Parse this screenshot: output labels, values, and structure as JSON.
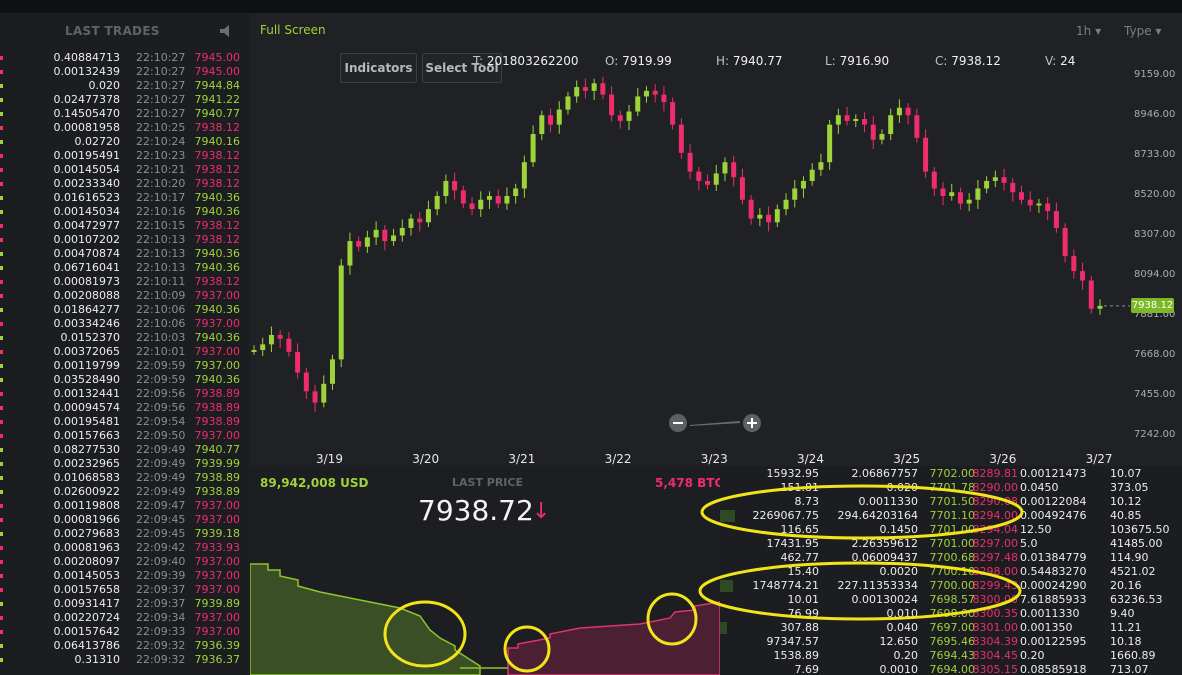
{
  "trades": {
    "title": "LAST TRADES",
    "rows": [
      {
        "amt": "0.40884713",
        "time": "22:10:27",
        "price": "7945.00",
        "dir": "dn"
      },
      {
        "amt": "0.00132439",
        "time": "22:10:27",
        "price": "7945.00",
        "dir": "dn"
      },
      {
        "amt": "0.020",
        "time": "22:10:27",
        "price": "7944.84",
        "dir": "up"
      },
      {
        "amt": "0.02477378",
        "time": "22:10:27",
        "price": "7941.22",
        "dir": "up"
      },
      {
        "amt": "0.14505470",
        "time": "22:10:27",
        "price": "7940.77",
        "dir": "up"
      },
      {
        "amt": "0.00081958",
        "time": "22:10:25",
        "price": "7938.12",
        "dir": "dn"
      },
      {
        "amt": "0.02720",
        "time": "22:10:24",
        "price": "7940.16",
        "dir": "up"
      },
      {
        "amt": "0.00195491",
        "time": "22:10:23",
        "price": "7938.12",
        "dir": "dn"
      },
      {
        "amt": "0.00145054",
        "time": "22:10:21",
        "price": "7938.12",
        "dir": "dn"
      },
      {
        "amt": "0.00233340",
        "time": "22:10:20",
        "price": "7938.12",
        "dir": "dn"
      },
      {
        "amt": "0.01616523",
        "time": "22:10:17",
        "price": "7940.36",
        "dir": "up"
      },
      {
        "amt": "0.00145034",
        "time": "22:10:16",
        "price": "7940.36",
        "dir": "up"
      },
      {
        "amt": "0.00472977",
        "time": "22:10:15",
        "price": "7938.12",
        "dir": "dn"
      },
      {
        "amt": "0.00107202",
        "time": "22:10:13",
        "price": "7938.12",
        "dir": "dn"
      },
      {
        "amt": "0.00470874",
        "time": "22:10:13",
        "price": "7940.36",
        "dir": "up"
      },
      {
        "amt": "0.06716041",
        "time": "22:10:13",
        "price": "7940.36",
        "dir": "up"
      },
      {
        "amt": "0.00081973",
        "time": "22:10:11",
        "price": "7938.12",
        "dir": "dn"
      },
      {
        "amt": "0.00208088",
        "time": "22:10:09",
        "price": "7937.00",
        "dir": "dn"
      },
      {
        "amt": "0.01864277",
        "time": "22:10:06",
        "price": "7940.36",
        "dir": "up"
      },
      {
        "amt": "0.00334246",
        "time": "22:10:06",
        "price": "7937.00",
        "dir": "dn"
      },
      {
        "amt": "0.0152370",
        "time": "22:10:03",
        "price": "7940.36",
        "dir": "up"
      },
      {
        "amt": "0.00372065",
        "time": "22:10:01",
        "price": "7937.00",
        "dir": "dn"
      },
      {
        "amt": "0.00119799",
        "time": "22:09:59",
        "price": "7937.00",
        "dir": "up"
      },
      {
        "amt": "0.03528490",
        "time": "22:09:59",
        "price": "7940.36",
        "dir": "up"
      },
      {
        "amt": "0.00132441",
        "time": "22:09:56",
        "price": "7938.89",
        "dir": "dn"
      },
      {
        "amt": "0.00094574",
        "time": "22:09:56",
        "price": "7938.89",
        "dir": "dn"
      },
      {
        "amt": "0.00195481",
        "time": "22:09:54",
        "price": "7938.89",
        "dir": "dn"
      },
      {
        "amt": "0.00157663",
        "time": "22:09:50",
        "price": "7937.00",
        "dir": "dn"
      },
      {
        "amt": "0.08277530",
        "time": "22:09:49",
        "price": "7940.77",
        "dir": "up"
      },
      {
        "amt": "0.00232965",
        "time": "22:09:49",
        "price": "7939.99",
        "dir": "up"
      },
      {
        "amt": "0.01068583",
        "time": "22:09:49",
        "price": "7938.89",
        "dir": "up"
      },
      {
        "amt": "0.02600922",
        "time": "22:09:49",
        "price": "7938.89",
        "dir": "up"
      },
      {
        "amt": "0.00119808",
        "time": "22:09:47",
        "price": "7937.00",
        "dir": "dn"
      },
      {
        "amt": "0.00081966",
        "time": "22:09:45",
        "price": "7937.00",
        "dir": "dn"
      },
      {
        "amt": "0.00279683",
        "time": "22:09:45",
        "price": "7939.18",
        "dir": "up"
      },
      {
        "amt": "0.00081963",
        "time": "22:09:42",
        "price": "7933.93",
        "dir": "dn"
      },
      {
        "amt": "0.00208097",
        "time": "22:09:40",
        "price": "7937.00",
        "dir": "dn"
      },
      {
        "amt": "0.00145053",
        "time": "22:09:39",
        "price": "7937.00",
        "dir": "dn"
      },
      {
        "amt": "0.00157658",
        "time": "22:09:37",
        "price": "7937.00",
        "dir": "dn"
      },
      {
        "amt": "0.00931417",
        "time": "22:09:37",
        "price": "7939.89",
        "dir": "up"
      },
      {
        "amt": "0.00220724",
        "time": "22:09:34",
        "price": "7937.00",
        "dir": "dn"
      },
      {
        "amt": "0.00157642",
        "time": "22:09:33",
        "price": "7937.00",
        "dir": "dn"
      },
      {
        "amt": "0.06413786",
        "time": "22:09:32",
        "price": "7936.39",
        "dir": "up"
      },
      {
        "amt": "0.31310",
        "time": "22:09:32",
        "price": "7936.37",
        "dir": "up"
      }
    ]
  },
  "chart": {
    "fullscreen_label": "Full Screen",
    "indicators_label": "Indicators",
    "select_tool_label": "Select Tool",
    "interval_label": "1h",
    "type_label": "Type",
    "ohlc": {
      "t_label": "T:",
      "t_value": "201803262200",
      "o_label": "O:",
      "o_value": "7919.99",
      "h_label": "H:",
      "h_value": "7940.77",
      "l_label": "L:",
      "l_value": "7916.90",
      "c_label": "C:",
      "c_value": "7938.12",
      "v_label": "V:",
      "v_value": "24"
    },
    "current_price_tag": "7938.12",
    "colors": {
      "up": "#9fd33a",
      "down": "#ee2d6a",
      "bg": "#1f2124"
    }
  },
  "chart_data": {
    "type": "line",
    "title": "",
    "xlabel": "",
    "ylabel": "",
    "x_ticks": [
      "3/19",
      "3/20",
      "3/21",
      "3/22",
      "3/23",
      "3/24",
      "3/25",
      "3/26",
      "3/27"
    ],
    "y_ticks": [
      9159.0,
      8946.0,
      8733.0,
      8520.0,
      8307.0,
      8094.0,
      7881.0,
      7668.0,
      7455.0,
      7242.0
    ],
    "ylim": [
      7242,
      9159
    ],
    "series": [
      {
        "values": [
          7700,
          7730,
          7780,
          7760,
          7690,
          7580,
          7480,
          7420,
          7520,
          7650,
          8150,
          8280,
          8250,
          8300,
          8340,
          8280,
          8310,
          8350,
          8400,
          8380,
          8450,
          8520,
          8600,
          8550,
          8480,
          8450,
          8500,
          8520,
          8480,
          8520,
          8560,
          8700,
          8850,
          8950,
          8900,
          8980,
          9050,
          9100,
          9080,
          9120,
          9060,
          8950,
          8920,
          8970,
          9050,
          9080,
          9060,
          9020,
          8900,
          8750,
          8650,
          8600,
          8580,
          8640,
          8700,
          8620,
          8500,
          8400,
          8420,
          8380,
          8450,
          8500,
          8560,
          8600,
          8660,
          8700,
          8900,
          8950,
          8920,
          8930,
          8900,
          8820,
          8850,
          8950,
          8990,
          8950,
          8830,
          8650,
          8560,
          8520,
          8540,
          8480,
          8500,
          8560,
          8600,
          8620,
          8590,
          8540,
          8500,
          8470,
          8480,
          8440,
          8350,
          8200,
          8120,
          8070,
          7920,
          7935
        ]
      }
    ],
    "grid": false
  },
  "depth": {
    "bid_total": "89,942,008 USD",
    "last_price_label": "LAST PRICE",
    "last_price": "7938.72",
    "last_price_arrow": "↓",
    "ask_total": "5,478 BTC"
  },
  "book": {
    "rows": [
      {
        "a": "15932.95",
        "b": "2.06867757",
        "bid": "7702.00",
        "ask": "8289.81",
        "d": "0.00121473",
        "e": "10.07",
        "bar": 0.0
      },
      {
        "a": "151.81",
        "b": "0.020",
        "bid": "7701.78",
        "ask": "8290.00",
        "d": "0.0450",
        "e": "373.05",
        "bar": 0.0
      },
      {
        "a": "8.73",
        "b": "0.0011330",
        "bid": "7701.50",
        "ask": "8290.08",
        "d": "0.00122084",
        "e": "10.12",
        "bar": 0.0
      },
      {
        "a": "2269067.75",
        "b": "294.64203164",
        "bid": "7701.10",
        "ask": "8294.00",
        "d": "0.00492476",
        "e": "40.85",
        "bar": 0.07
      },
      {
        "a": "116.65",
        "b": "0.1450",
        "bid": "7701.00",
        "ask": "8294.04",
        "d": "12.50",
        "e": "103675.50",
        "bar": 0.0
      },
      {
        "a": "17431.95",
        "b": "2.26359612",
        "bid": "7701.00",
        "ask": "8297.00",
        "d": "5.0",
        "e": "41485.00",
        "bar": 0.0
      },
      {
        "a": "462.77",
        "b": "0.06009437",
        "bid": "7700.68",
        "ask": "8297.48",
        "d": "0.01384779",
        "e": "114.90",
        "bar": 0.0
      },
      {
        "a": "15.40",
        "b": "0.0020",
        "bid": "7700.10",
        "ask": "8298.00",
        "d": "0.54483270",
        "e": "4521.02",
        "bar": 0.0
      },
      {
        "a": "1748774.21",
        "b": "227.11353334",
        "bid": "7700.00",
        "ask": "8299.43",
        "d": "0.00024290",
        "e": "20.16",
        "bar": 0.06
      },
      {
        "a": "10.01",
        "b": "0.00130024",
        "bid": "7698.57",
        "ask": "8300.00",
        "d": "7.61885933",
        "e": "63236.53",
        "bar": 0.0
      },
      {
        "a": "76.99",
        "b": "0.010",
        "bid": "7698.00",
        "ask": "8300.35",
        "d": "0.0011330",
        "e": "9.40",
        "bar": 0.0
      },
      {
        "a": "307.88",
        "b": "0.040",
        "bid": "7697.00",
        "ask": "8301.00",
        "d": "0.001350",
        "e": "11.21",
        "bar": 0.03
      },
      {
        "a": "97347.57",
        "b": "12.650",
        "bid": "7695.46",
        "ask": "8304.39",
        "d": "0.00122595",
        "e": "10.18",
        "bar": 0.0
      },
      {
        "a": "1538.89",
        "b": "0.20",
        "bid": "7694.43",
        "ask": "8304.45",
        "d": "0.20",
        "e": "1660.89",
        "bar": 0.0
      },
      {
        "a": "7.69",
        "b": "0.0010",
        "bid": "7694.00",
        "ask": "8305.15",
        "d": "0.08585918",
        "e": "713.07",
        "bar": 0.0
      }
    ]
  }
}
